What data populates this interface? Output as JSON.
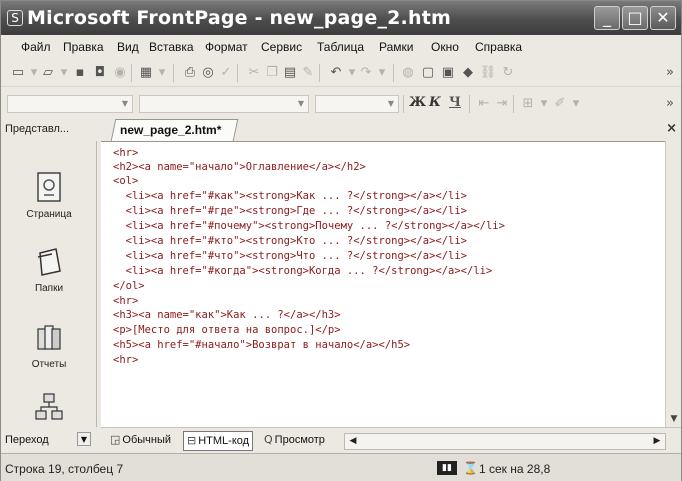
{
  "window": {
    "app_icon": "S",
    "title": "Microsoft FrontPage - new_page_2.htm"
  },
  "menu": [
    {
      "label": "Файл"
    },
    {
      "label": "Правка"
    },
    {
      "label": "Вид"
    },
    {
      "label": "Вставка"
    },
    {
      "label": "Формат"
    },
    {
      "label": "Сервис"
    },
    {
      "label": "Таблица"
    },
    {
      "label": "Рамки"
    },
    {
      "label": "Окно"
    },
    {
      "label": "Справка"
    }
  ],
  "format_bar": {
    "bold": "Ж",
    "italic": "К",
    "underline": "Ч"
  },
  "views": {
    "header": "Представл...",
    "items": [
      {
        "label": "Страница",
        "icon": "page-icon"
      },
      {
        "label": "Папки",
        "icon": "folders-icon"
      },
      {
        "label": "Отчеты",
        "icon": "reports-icon"
      },
      {
        "label": "Переход",
        "icon": "navigation-icon"
      }
    ]
  },
  "tab": {
    "name": "new_page_2.htm*",
    "close": "×"
  },
  "code": [
    "<hr>",
    "<h2><a name=\"начало\">Оглавление</a></h2>",
    "<ol>",
    "  <li><a href=\"#как\"><strong>Как ... ?</strong></a></li>",
    "  <li><a href=\"#где\"><strong>Где ... ?</strong></a></li>",
    "  <li><a href=\"#почему\"><strong>Почему ... ?</strong></a></li>",
    "  <li><a href=\"#кто\"><strong>Кто ... ?</strong></a></li>",
    "  <li><a href=\"#что\"><strong>Что ... ?</strong></a></li>",
    "  <li><a href=\"#когда\"><strong>Когда ... ?</strong></a></li>",
    "</ol>",
    "<hr>",
    "<h3><a name=\"как\">Как ... ?</a></h3>",
    "<p>[Место для ответа на вопрос.]</p>",
    "<h5><a href=\"#начало\">Возврат в начало</a></h5>",
    "<hr>"
  ],
  "view_tabs": {
    "normal": "Обычный",
    "html": "HTML-код",
    "preview": "Просмотр"
  },
  "status": {
    "position": "Строка 19, столбец 7",
    "time": "1 сек на 28,8"
  }
}
